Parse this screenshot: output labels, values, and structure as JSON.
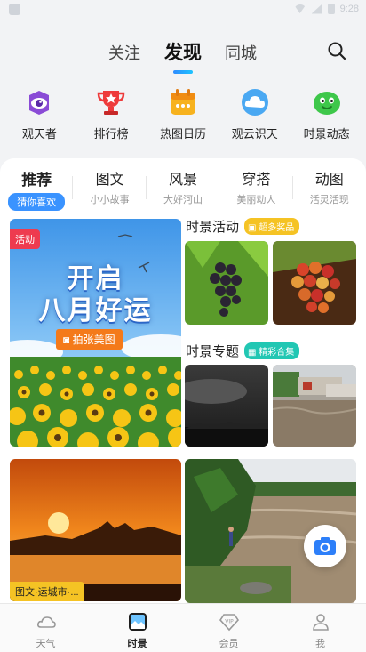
{
  "status_bar": {
    "time": "9:28"
  },
  "top_tabs": [
    {
      "label": "关注",
      "active": false
    },
    {
      "label": "发现",
      "active": true
    },
    {
      "label": "同城",
      "active": false
    }
  ],
  "shortcuts": [
    {
      "label": "观天者",
      "icon": "eye-icon"
    },
    {
      "label": "排行榜",
      "icon": "trophy-icon"
    },
    {
      "label": "热图日历",
      "icon": "calendar-icon"
    },
    {
      "label": "观云识天",
      "icon": "cloud-icon"
    },
    {
      "label": "时景动态",
      "icon": "mascot-icon"
    }
  ],
  "categories": [
    {
      "title": "推荐",
      "sub": "猜你喜欢",
      "active": true
    },
    {
      "title": "图文",
      "sub": "小小故事",
      "active": false
    },
    {
      "title": "风景",
      "sub": "大好河山",
      "active": false
    },
    {
      "title": "穿搭",
      "sub": "美丽动人",
      "active": false
    },
    {
      "title": "动图",
      "sub": "活灵活现",
      "active": false
    }
  ],
  "promo": {
    "badge": "活动",
    "line1": "开启",
    "line2": "八月好运",
    "button": "拍张美图"
  },
  "activity": {
    "title": "时景活动",
    "tag": "超多奖品"
  },
  "topic": {
    "title": "时景专题",
    "tag": "精彩合集"
  },
  "feed": {
    "left_tag": "图文·运城市·..."
  },
  "bottom_nav": [
    {
      "label": "天气",
      "active": false
    },
    {
      "label": "时景",
      "active": true
    },
    {
      "label": "会员",
      "active": false
    },
    {
      "label": "我",
      "active": false
    }
  ],
  "colors": {
    "accent": "#3a93ff",
    "badge_red": "#ee3b4f",
    "tag_yellow": "#f5c324",
    "tag_teal": "#21c7b3",
    "promo_orange": "#f47a1a"
  }
}
